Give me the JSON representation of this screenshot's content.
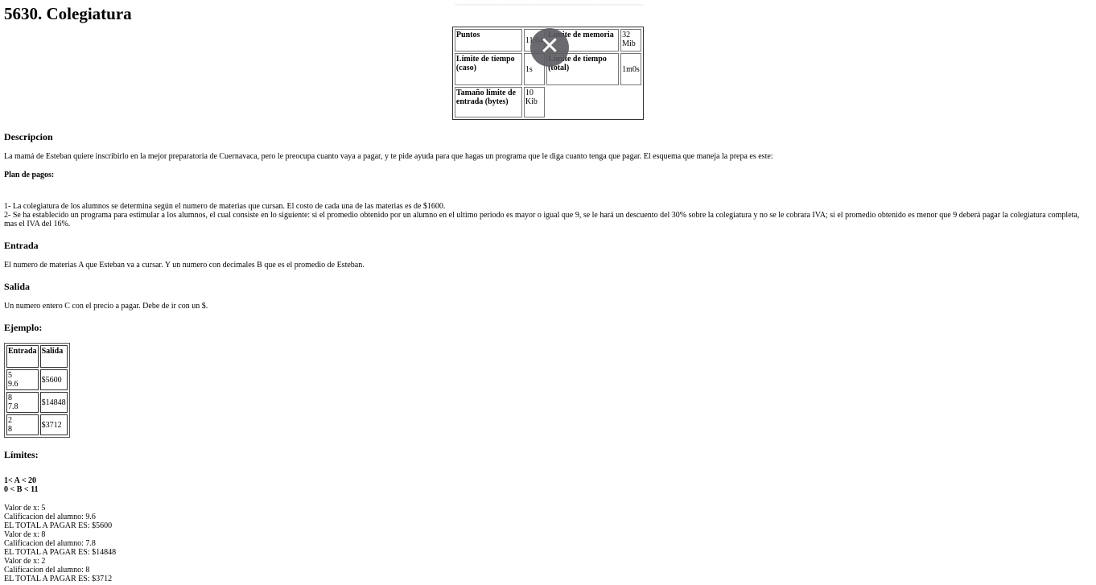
{
  "title": "5630. Colegiatura",
  "meta": {
    "puntos_label": "Puntos",
    "puntos": "11.64",
    "mem_label": "Límite de memoria",
    "mem": "32 Mib",
    "tcaso_label": "Límite de tiempo (caso)",
    "tcaso": "1s",
    "ttotal_label": "Límite de tiempo (total)",
    "ttotal": "1m0s",
    "input_label": "Tamaño límite de entrada (bytes)",
    "input": "10 Kib"
  },
  "desc_heading": "Descripcion",
  "desc": "La mamá de Esteban quiere inscribirlo en la mejor preparatoria de Cuernavaca, pero le preocupa cuanto vaya a pagar, y te pide ayuda para que hagas un programa que le diga cuanto tenga que pagar. El esquema que maneja la prepa es este:",
  "plan_heading": "Plan de pagos:",
  "plan": [
    "1- La colegiatura de los alumnos se determina según el numero de materias que cursan. El costo de cada una de las materias es de $1600.",
    "2- Se ha establecido un programa para estimular a los alumnos, el cual consiste en lo siguiente: si el promedio obtenido por un alumno en el ultimo periodo es mayor o igual que 9, se le hará un descuento del 30% sobre la colegiatura y no se le cobrara IVA; si el promedio obtenido es menor que 9 deberá pagar la colegiatura completa, mas el IVA del 16%."
  ],
  "entrada_heading": "Entrada",
  "entrada": "El numero de materias A que Esteban va a cursar. Y un numero con decimales B que es el promedio de Esteban.",
  "salida_heading": "Salida",
  "salida": "Un numero entero C con el precio a pagar. Debe de ir con un $.",
  "ejemplo_heading": "Ejemplo:",
  "example": {
    "headers": [
      "Entrada",
      "Salida"
    ],
    "rows": [
      {
        "in1": "5",
        "in2": "9.6",
        "out": "$5600"
      },
      {
        "in1": "8",
        "in2": "7.8",
        "out": "$14848"
      },
      {
        "in1": "2",
        "in2": "8",
        "out": "$3712"
      }
    ]
  },
  "limites_heading": "Límites:",
  "limites": [
    "1< A < 20",
    "0 < B < 11"
  ],
  "output_lines": [
    "Valor de x: 5",
    "Calificacion del alumno: 9.6",
    "EL TOTAL A PAGAR ES: $5600",
    "Valor de x: 8",
    "Calificacion del alumno: 7.8",
    "EL TOTAL A PAGAR ES: $14848",
    "Valor de x: 2",
    "Calificacion del alumno: 8",
    "EL TOTAL A PAGAR ES: $3712"
  ],
  "close_icon": "close-icon"
}
